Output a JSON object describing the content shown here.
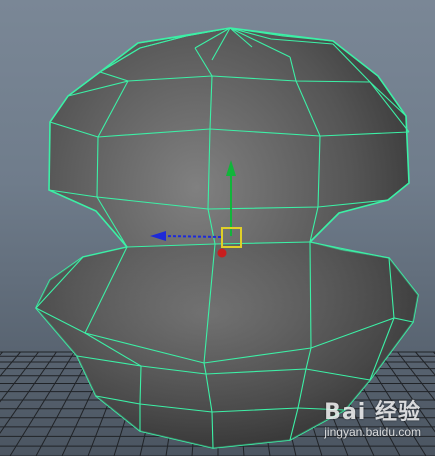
{
  "viewport": {
    "background_top": "#7a8796",
    "background_bottom": "#4b5561",
    "grid_color": "#202327",
    "mesh_fill_light": "#7a7a7a",
    "mesh_fill_dark": "#2e2e2e",
    "wire_color": "#3cf0a6"
  },
  "manipulator": {
    "x_axis_color": "#1e2ad8",
    "y_axis_color": "#11b53a",
    "pivot_color": "#e0d028",
    "origin_color": "#c81e1e"
  },
  "watermark": {
    "logo_text": "Bai 经验",
    "url_text": "jingyan.baidu.com"
  }
}
